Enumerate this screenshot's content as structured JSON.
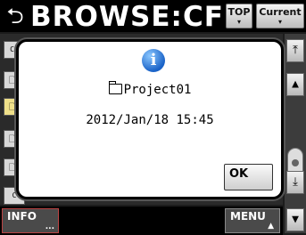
{
  "header": {
    "back_icon": "return-arrow-icon",
    "title": "BROWSE:CF",
    "top_label": "TOP",
    "current_label": "Current"
  },
  "list": {
    "row_icons": [
      "cf-card-icon",
      "folder-icon",
      "folder-icon",
      "folder-icon",
      "folder-icon",
      "cf-card-icon"
    ],
    "selected_row": 2
  },
  "scrollbar": {
    "buttons": [
      "page-up-icon",
      "up-icon",
      "down-icon",
      "page-down-icon"
    ]
  },
  "footer": {
    "info_label": "INFO",
    "info_dots": "...",
    "menu_label": "MENU"
  },
  "dialog": {
    "icon": "info-icon",
    "folder_name": "Project01",
    "date_time": "2012/Jan/18 15:45",
    "ok_label": "OK"
  },
  "colors": {
    "dialog_bg": "#ffffff",
    "selected_row": "#efe08a",
    "info_icon": "#1a63c8"
  }
}
